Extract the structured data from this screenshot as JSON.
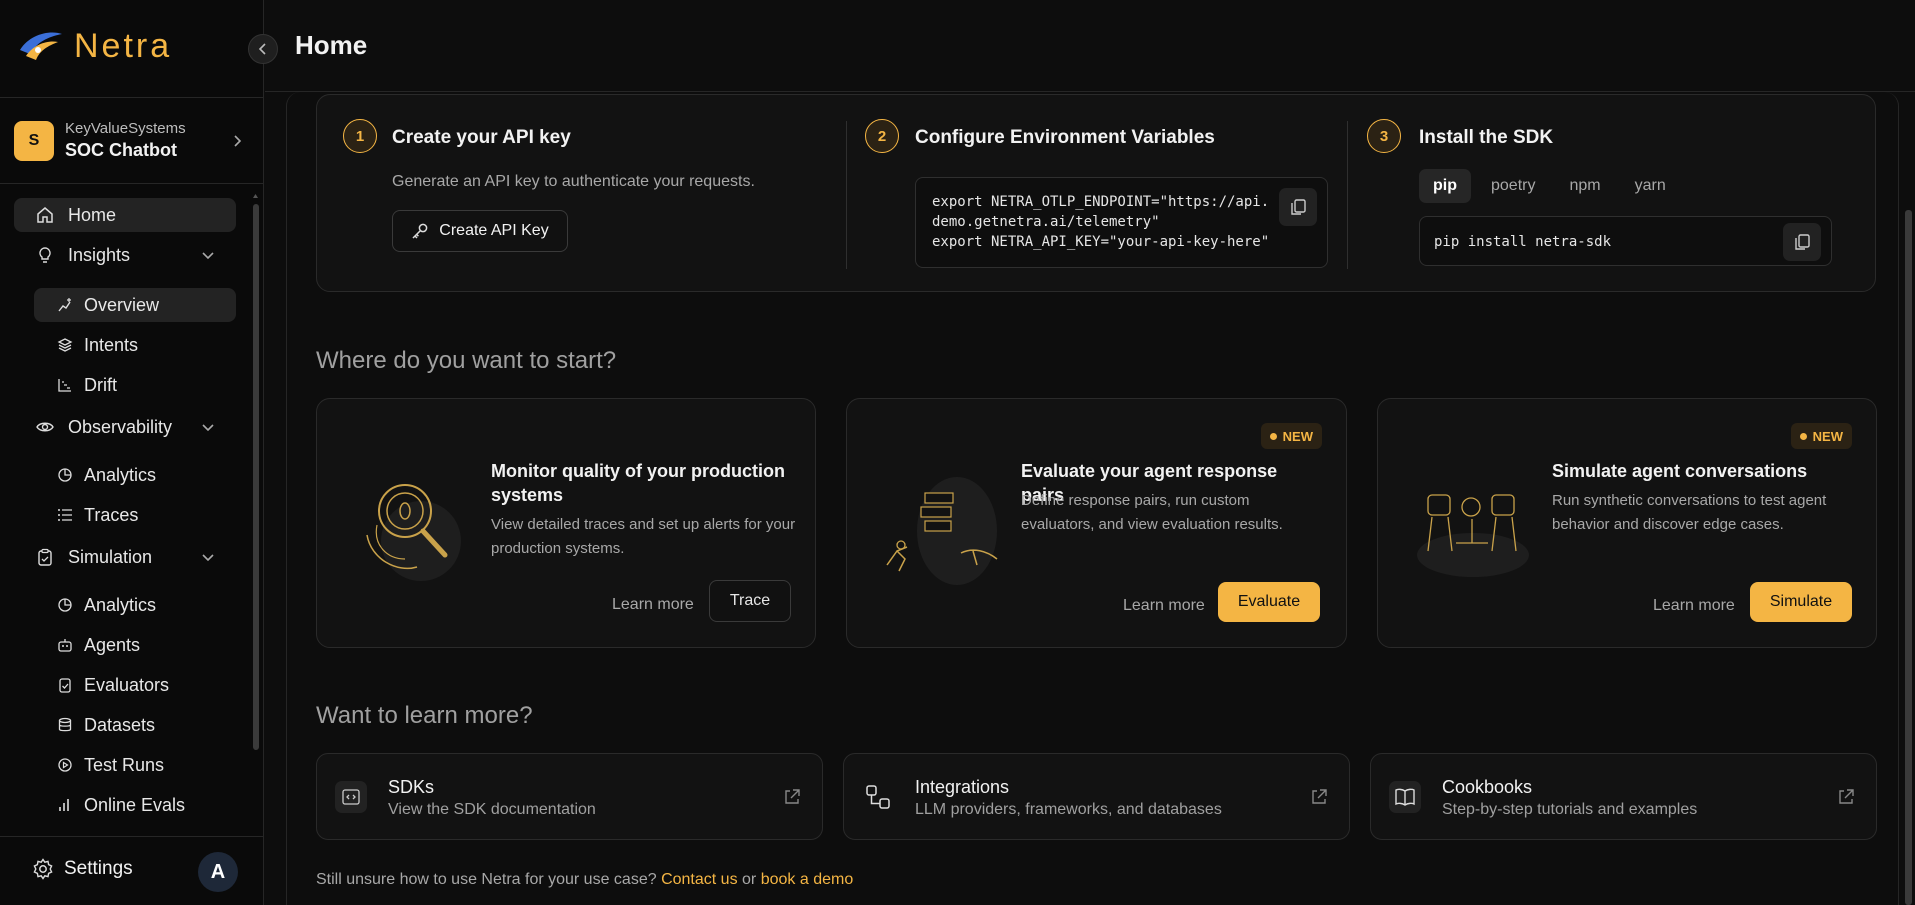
{
  "app": {
    "name": "Netra",
    "accent": "#f4b544"
  },
  "project": {
    "initial": "S",
    "org": "KeyValueSystems",
    "name": "SOC Chatbot"
  },
  "nav": {
    "home": "Home",
    "insights": {
      "label": "Insights",
      "items": [
        "Overview",
        "Intents",
        "Drift"
      ]
    },
    "observability": {
      "label": "Observability",
      "items": [
        "Analytics",
        "Traces"
      ]
    },
    "simulation": {
      "label": "Simulation",
      "items": [
        "Analytics",
        "Agents",
        "Evaluators",
        "Datasets",
        "Test Runs",
        "Online Evals"
      ]
    },
    "settings": "Settings",
    "user_initial": "A"
  },
  "header": {
    "title": "Home"
  },
  "setup": {
    "step1": {
      "num": "1",
      "title": "Create your API key",
      "desc": "Generate an API key to authenticate your requests.",
      "button": "Create API Key"
    },
    "step2": {
      "num": "2",
      "title": "Configure Environment Variables",
      "code": [
        "export NETRA_OTLP_ENDPOINT=\"https://api.",
        "demo.getnetra.ai/telemetry\"",
        "export NETRA_API_KEY=\"your-api-key-here\""
      ]
    },
    "step3": {
      "num": "3",
      "title": "Install the SDK",
      "tabs": [
        "pip",
        "poetry",
        "npm",
        "yarn"
      ],
      "active_tab": "pip",
      "code": "pip install netra-sdk"
    }
  },
  "start": {
    "title": "Where do you want to start?",
    "cards": [
      {
        "title": "Monitor quality of your production systems",
        "desc": "View detailed traces and set up alerts for your production systems.",
        "learn": "Learn more",
        "action": "Trace",
        "badge": ""
      },
      {
        "title": "Evaluate your agent response pairs",
        "desc": "Define response pairs, run custom evaluators, and view evaluation results.",
        "learn": "Learn more",
        "action": "Evaluate",
        "badge": "NEW"
      },
      {
        "title": "Simulate agent conversations",
        "desc": "Run synthetic conversations to test agent behavior and discover edge cases.",
        "learn": "Learn more",
        "action": "Simulate",
        "badge": "NEW"
      }
    ]
  },
  "learn": {
    "title": "Want to learn more?",
    "cards": [
      {
        "title": "SDKs",
        "desc": "View the SDK documentation",
        "icon": "code-icon"
      },
      {
        "title": "Integrations",
        "desc": "LLM providers, frameworks, and databases",
        "icon": "integrations-icon"
      },
      {
        "title": "Cookbooks",
        "desc": "Step-by-step tutorials and examples",
        "icon": "book-icon"
      }
    ]
  },
  "footer": {
    "text": "Still unsure how to use Netra for your use case?",
    "contact": "Contact us",
    "or": "or",
    "demo": "book a demo"
  }
}
